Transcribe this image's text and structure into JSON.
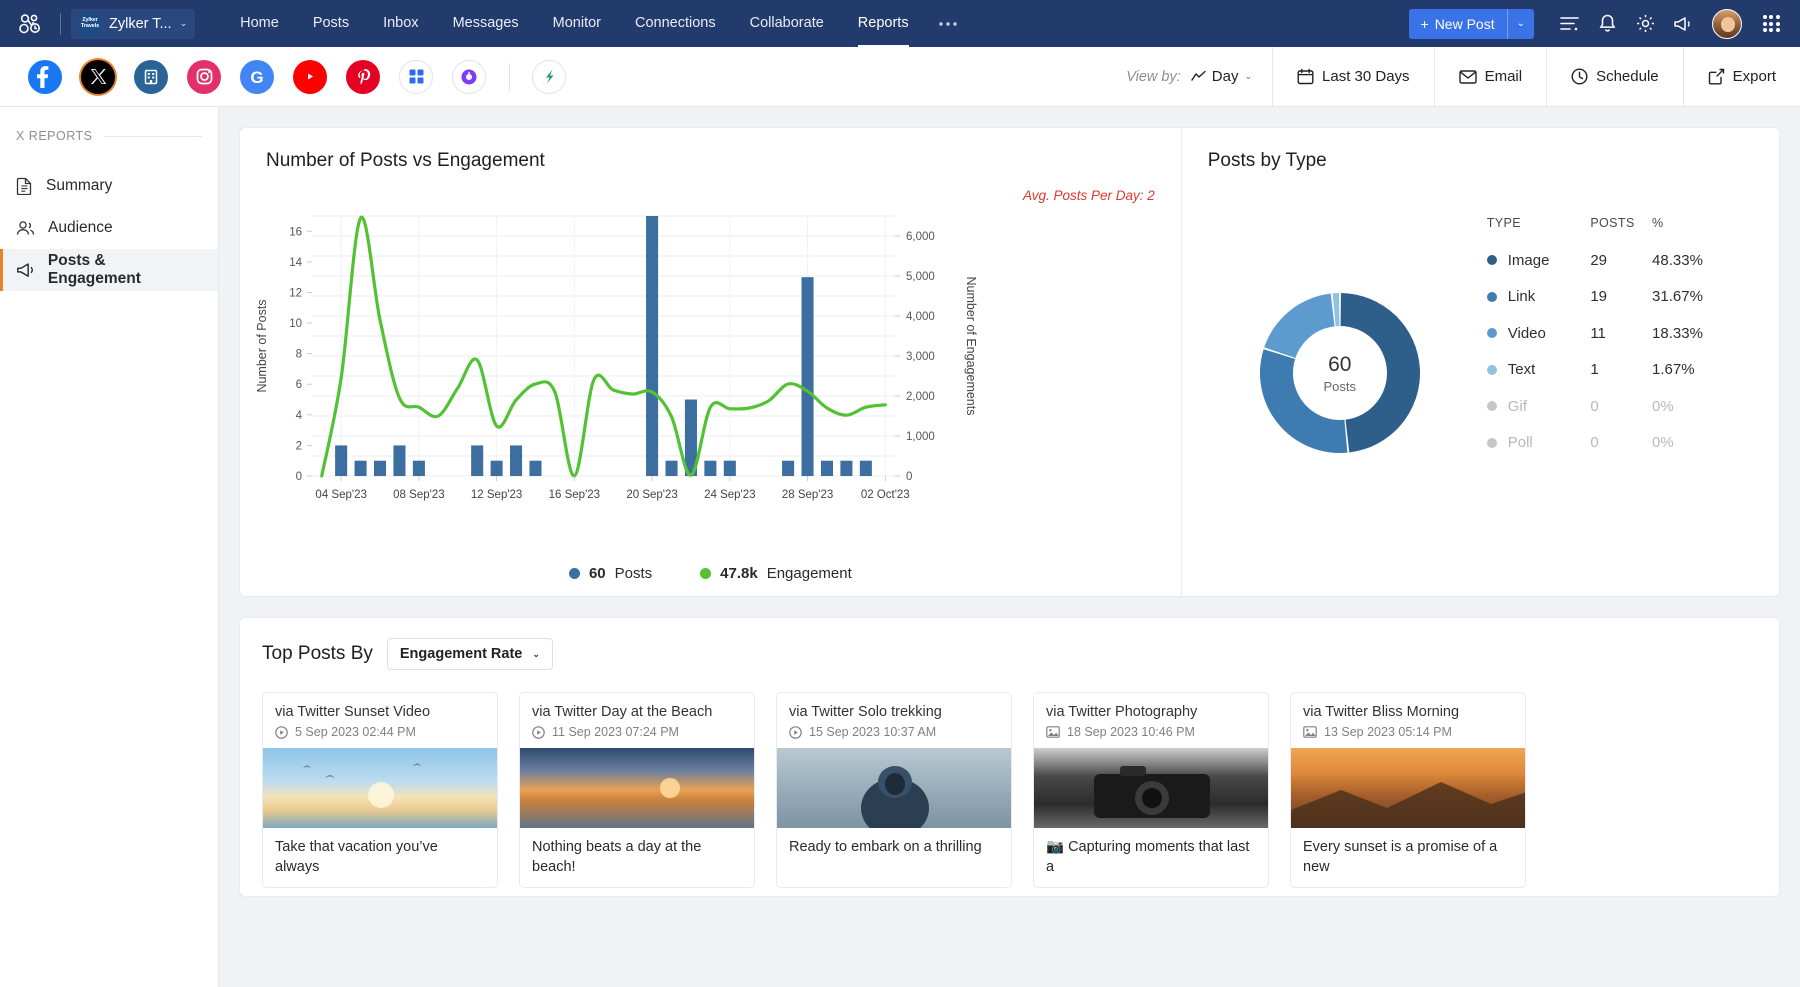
{
  "topnav": {
    "brand": {
      "logo_lines": [
        "Zylker",
        "Travels"
      ],
      "name": "Zylker T...",
      "chevron": "⌄"
    },
    "links": [
      {
        "label": "Home",
        "active": false
      },
      {
        "label": "Posts",
        "active": false
      },
      {
        "label": "Inbox",
        "active": false
      },
      {
        "label": "Messages",
        "active": false
      },
      {
        "label": "Monitor",
        "active": false
      },
      {
        "label": "Connections",
        "active": false
      },
      {
        "label": "Collaborate",
        "active": false
      },
      {
        "label": "Reports",
        "active": true
      }
    ],
    "more": "●●●",
    "new_post": {
      "label": "New Post",
      "plus": "+",
      "caret": "⌄"
    },
    "icons": [
      "list-icon",
      "bell-icon",
      "gear-icon",
      "megaphone-icon",
      "avatar",
      "apps-grid-icon"
    ]
  },
  "channels": [
    {
      "name": "facebook",
      "color": "#1877f2",
      "selected": false
    },
    {
      "name": "x-twitter",
      "color": "#000000",
      "selected": true
    },
    {
      "name": "linkedin",
      "color": "#2a6496",
      "selected": false
    },
    {
      "name": "instagram",
      "color": "#e1306c",
      "selected": false
    },
    {
      "name": "google-business",
      "color": "#4285f4",
      "selected": false
    },
    {
      "name": "youtube",
      "color": "#ff0000",
      "selected": false
    },
    {
      "name": "pinterest",
      "color": "#e60023",
      "selected": false
    },
    {
      "name": "mastodon",
      "color": "#2c6bed",
      "selected": false
    },
    {
      "name": "tiktok-purple",
      "color": "#7d3cf8",
      "selected": false
    },
    {
      "name": "zoho-extra",
      "color": "#22a06b",
      "selected": false
    }
  ],
  "toolbar": {
    "view_by_label": "View by:",
    "view_by_value": "Day",
    "date_range": "Last 30 Days",
    "email": "Email",
    "schedule": "Schedule",
    "export": "Export"
  },
  "sidebar": {
    "heading": "X REPORTS",
    "items": [
      {
        "label": "Summary",
        "icon": "document-icon",
        "active": false
      },
      {
        "label": "Audience",
        "icon": "people-icon",
        "active": false
      },
      {
        "label": "Posts & Engagement",
        "icon": "megaphone-icon",
        "active": true
      }
    ]
  },
  "posts_vs_engagement": {
    "title": "Number of Posts vs Engagement",
    "avg_note": "Avg. Posts Per Day: 2",
    "legend": [
      {
        "value": "60",
        "label": "Posts",
        "color": "#3c6e9f"
      },
      {
        "value": "47.8k",
        "label": "Engagement",
        "color": "#52c234"
      }
    ]
  },
  "posts_by_type": {
    "title": "Posts by Type",
    "center_value": "60",
    "center_label": "Posts",
    "columns": [
      "TYPE",
      "POSTS",
      "%"
    ],
    "rows": [
      {
        "type": "Image",
        "posts": "29",
        "pct": "48.33%",
        "color": "#2e5f8a",
        "dim": false
      },
      {
        "type": "Link",
        "posts": "19",
        "pct": "31.67%",
        "color": "#3d7bb0",
        "dim": false
      },
      {
        "type": "Video",
        "posts": "11",
        "pct": "18.33%",
        "color": "#5d9bce",
        "dim": false
      },
      {
        "type": "Text",
        "posts": "1",
        "pct": "1.67%",
        "color": "#92c2e2",
        "dim": false
      },
      {
        "type": "Gif",
        "posts": "0",
        "pct": "0%",
        "color": "#c3c7cb",
        "dim": true
      },
      {
        "type": "Poll",
        "posts": "0",
        "pct": "0%",
        "color": "#c3c7cb",
        "dim": true
      }
    ]
  },
  "top_posts": {
    "title": "Top Posts By",
    "sort_value": "Engagement Rate",
    "cards": [
      {
        "via": "via Twitter Sunset Video",
        "date": "5 Sep 2023 02:44 PM",
        "media_icon": "video-icon",
        "thumb": "imgA",
        "text": "Take that vacation you’ve always"
      },
      {
        "via": "via Twitter Day at the Beach",
        "date": "11 Sep 2023 07:24 PM",
        "media_icon": "video-icon",
        "thumb": "imgB",
        "text": "Nothing beats a day at the beach!"
      },
      {
        "via": "via Twitter Solo trekking",
        "date": "15 Sep 2023 10:37 AM",
        "media_icon": "video-icon",
        "thumb": "imgC",
        "text": "Ready to embark on a thrilling"
      },
      {
        "via": "via Twitter Photography",
        "date": "18 Sep 2023 10:46 PM",
        "media_icon": "image-icon",
        "thumb": "imgD",
        "text": "📷 Capturing moments that last a"
      },
      {
        "via": "via Twitter Bliss Morning",
        "date": "13 Sep 2023 05:14 PM",
        "media_icon": "image-icon",
        "thumb": "imgE",
        "text": "Every sunset is a promise of a new"
      }
    ]
  },
  "chart_data": {
    "type": "bar",
    "title": "Number of Posts vs Engagement",
    "xlabel": "",
    "ylabel": "Number of Posts",
    "y2label": "Number of Engagements",
    "ylim": [
      0,
      17
    ],
    "y2lim": [
      0,
      6500
    ],
    "yticks": [
      0,
      2,
      4,
      6,
      8,
      10,
      12,
      14,
      16
    ],
    "y2ticks": [
      0,
      1000,
      2000,
      3000,
      4000,
      5000,
      6000
    ],
    "y2ticklabels": [
      "0",
      "1,000",
      "2,000",
      "3,000",
      "4,000",
      "5,000",
      "6,000"
    ],
    "xticklabels": [
      "04 Sep'23",
      "08 Sep'23",
      "12 Sep'23",
      "16 Sep'23",
      "20 Sep'23",
      "24 Sep'23",
      "28 Sep'23",
      "02 Oct'23"
    ],
    "grid": true,
    "legend_position": "bottom",
    "x": [
      "03 Sep'23",
      "04 Sep'23",
      "05 Sep'23",
      "06 Sep'23",
      "07 Sep'23",
      "08 Sep'23",
      "09 Sep'23",
      "10 Sep'23",
      "11 Sep'23",
      "12 Sep'23",
      "13 Sep'23",
      "14 Sep'23",
      "15 Sep'23",
      "16 Sep'23",
      "17 Sep'23",
      "18 Sep'23",
      "19 Sep'23",
      "20 Sep'23",
      "21 Sep'23",
      "22 Sep'23",
      "23 Sep'23",
      "24 Sep'23",
      "25 Sep'23",
      "26 Sep'23",
      "27 Sep'23",
      "28 Sep'23",
      "29 Sep'23",
      "30 Sep'23",
      "01 Oct'23",
      "02 Oct'23"
    ],
    "series": [
      {
        "name": "Posts",
        "type": "bar",
        "axis": "left",
        "color": "#3c6e9f",
        "values": [
          0,
          2,
          1,
          1,
          2,
          1,
          0,
          0,
          2,
          1,
          2,
          1,
          0,
          0,
          0,
          0,
          0,
          17,
          1,
          5,
          1,
          1,
          0,
          0,
          1,
          13,
          1,
          1,
          1,
          0
        ]
      },
      {
        "name": "Engagement",
        "type": "line",
        "axis": "right",
        "color": "#52c234",
        "values": [
          0,
          2450,
          6450,
          3900,
          1950,
          1720,
          1500,
          2200,
          2900,
          1250,
          1900,
          2300,
          2100,
          0,
          2400,
          2150,
          2050,
          2100,
          1480,
          20,
          1720,
          1680,
          1700,
          1880,
          2300,
          2120,
          1700,
          1520,
          1720,
          1780
        ]
      }
    ]
  }
}
